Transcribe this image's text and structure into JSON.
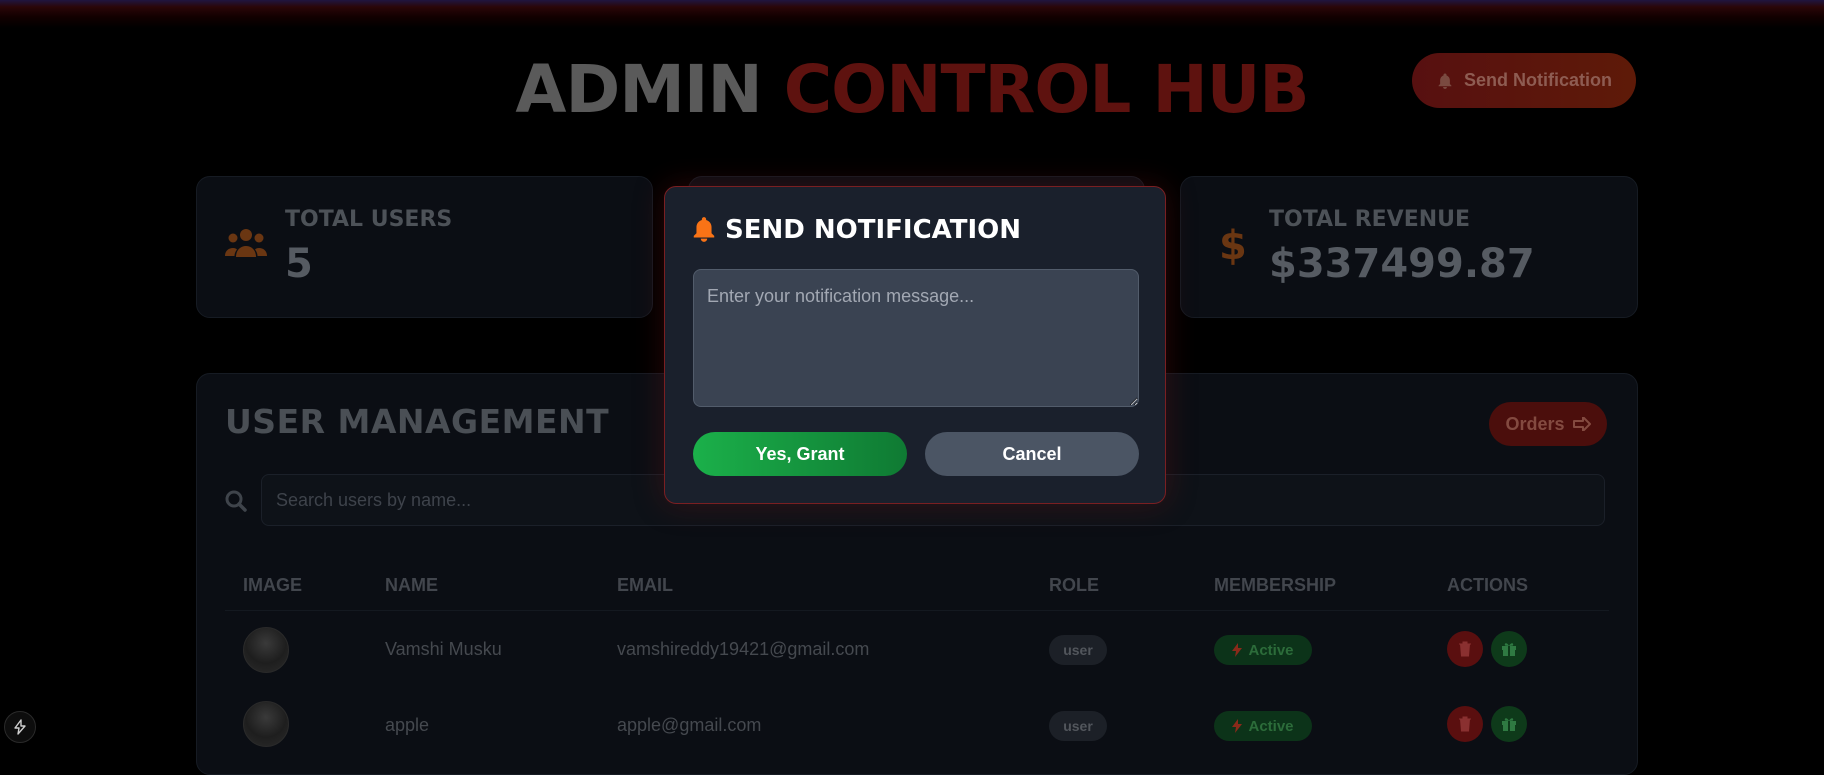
{
  "header": {
    "title_part1": "ADMIN",
    "title_part2": "CONTROL HUB",
    "send_notification_label": "Send Notification"
  },
  "stats": [
    {
      "label": "TOTAL USERS",
      "value": "5",
      "icon": "users-icon"
    },
    {
      "label": "",
      "value": "",
      "icon": ""
    },
    {
      "label": "TOTAL REVENUE",
      "value": "$337499.87",
      "icon": "dollar-icon"
    }
  ],
  "user_management": {
    "title": "USER MANAGEMENT",
    "orders_label": "Orders",
    "search_placeholder": "Search users by name...",
    "columns": [
      "IMAGE",
      "NAME",
      "EMAIL",
      "ROLE",
      "MEMBERSHIP",
      "ACTIONS"
    ],
    "rows": [
      {
        "name": "Vamshi Musku",
        "email": "vamshireddy19421@gmail.com",
        "role": "user",
        "membership": "Active"
      },
      {
        "name": "apple",
        "email": "apple@gmail.com",
        "role": "user",
        "membership": "Active"
      }
    ]
  },
  "modal": {
    "title": "SEND NOTIFICATION",
    "placeholder": "Enter your notification message...",
    "confirm_label": "Yes, Grant",
    "cancel_label": "Cancel"
  },
  "colors": {
    "background": "#000000",
    "modal_bg": "#1a202c",
    "modal_border": "#7a1f22",
    "grant_green": "#16a34a",
    "cancel_gray": "#4b5564",
    "bell_orange": "#f97316"
  }
}
